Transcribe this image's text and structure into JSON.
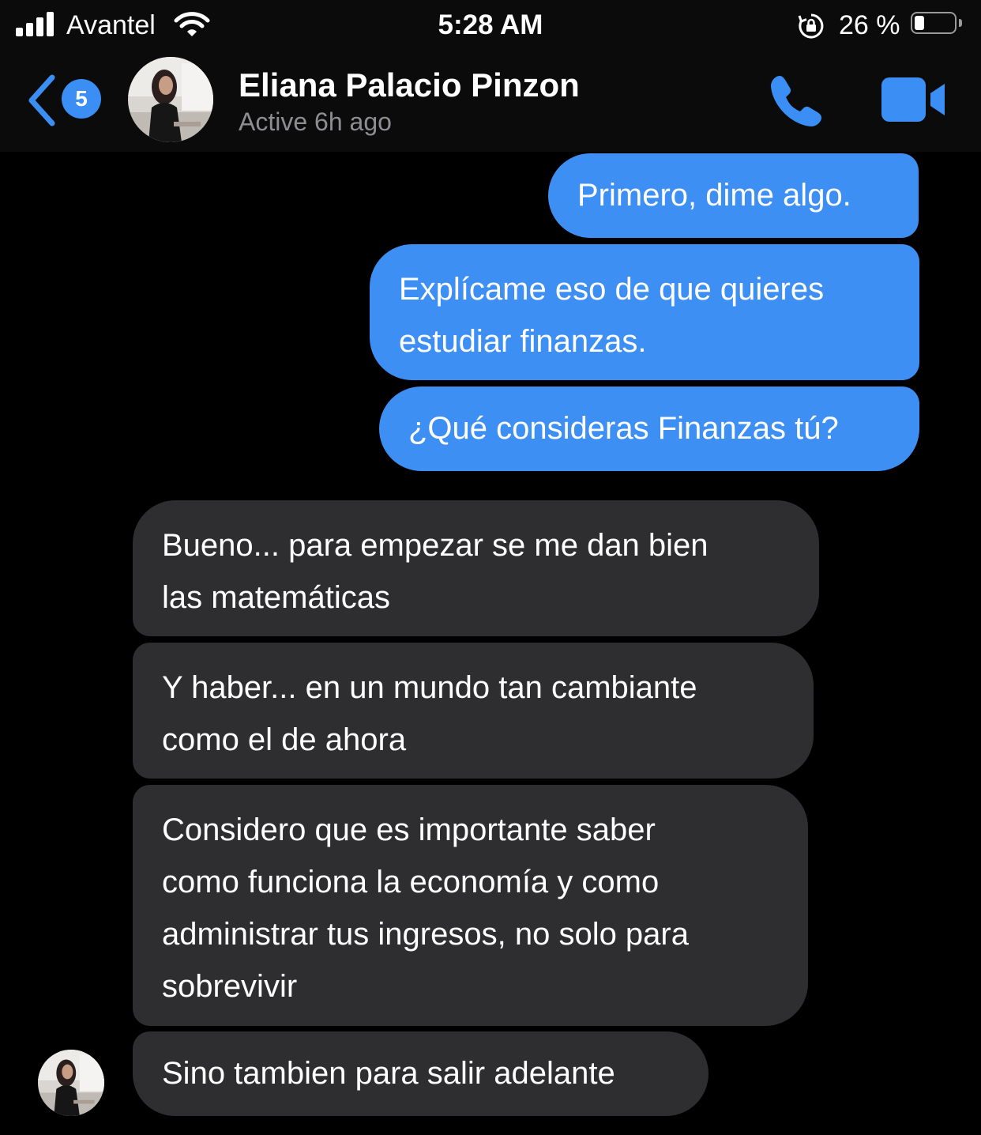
{
  "status_bar": {
    "carrier": "Avantel",
    "time": "5:28 AM",
    "battery_percent": "26 %",
    "battery_level": 0.26,
    "signal_bars": 4,
    "icons": [
      "signal-icon",
      "wifi-icon",
      "rotation-lock-icon",
      "battery-icon"
    ]
  },
  "header": {
    "back_badge": "5",
    "contact_name": "Eliana Palacio Pinzon",
    "contact_status": "Active 6h ago",
    "icons": [
      "back-chevron-icon",
      "phone-icon",
      "video-camera-icon"
    ],
    "accent_color": "#3b8ef3"
  },
  "messages": [
    {
      "direction": "out",
      "lines": [
        "Primero, dime algo."
      ]
    },
    {
      "direction": "out",
      "lines": [
        "Explícame eso de que quieres",
        "estudiar finanzas."
      ]
    },
    {
      "direction": "out",
      "lines": [
        "¿Qué consideras Finanzas tú?"
      ]
    },
    {
      "direction": "in",
      "lines": [
        "Bueno... para empezar se me dan bien",
        "las matemáticas"
      ]
    },
    {
      "direction": "in",
      "lines": [
        "Y haber... en un mundo tan cambiante",
        "como el de ahora"
      ]
    },
    {
      "direction": "in",
      "lines": [
        "Considero que es importante saber",
        "como funciona la economía y como",
        "administrar tus ingresos, no solo para",
        "sobrevivir"
      ]
    },
    {
      "direction": "in",
      "lines": [
        "Sino tambien para salir adelante"
      ]
    }
  ],
  "colors": {
    "outgoing_bubble": "#3e8ff4",
    "incoming_bubble": "#2e2e30",
    "background": "#000000"
  }
}
